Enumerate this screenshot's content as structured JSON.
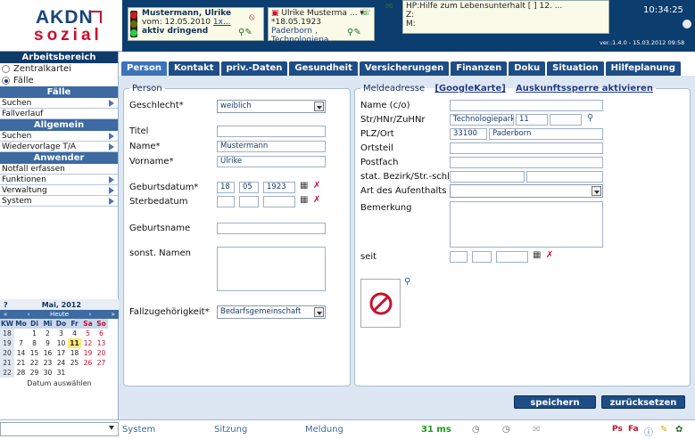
{
  "logo": {
    "line1": "AKDN",
    "line2": "sozial"
  },
  "header": {
    "case1": {
      "name": "Mustermann, Ulrike",
      "date_prefix": "vom: 12.05.2010",
      "link": "1x...",
      "status": "aktiv dringend"
    },
    "case2": {
      "name": "Ulrike Musterma ...",
      "date": "*18.05.1923",
      "addr": "Paderborn , Technologiepa ..."
    },
    "case3": {
      "line1": "HP:Hilfe zum Lebensunterhalt [ ] 12. ...",
      "line2": "Z:",
      "line3": "M:"
    },
    "time": "10:34:25",
    "version": "ver.:1.4.0 - 15.03.2012 09:58"
  },
  "sidebar": {
    "title": "Arbeitsbereich",
    "radios": [
      {
        "label": "Zentralkartei",
        "checked": false
      },
      {
        "label": "Fälle",
        "checked": true
      }
    ],
    "sections": [
      {
        "title": "Fälle",
        "items": [
          "Suchen",
          "Fallverlauf"
        ]
      },
      {
        "title": "Allgemein",
        "items": [
          "Suchen",
          "Wiedervorlage T/A"
        ]
      },
      {
        "title": "Anwender",
        "items": [
          "Notfall erfassen",
          "Funktionen",
          "Verwaltung",
          "System"
        ]
      }
    ]
  },
  "calendar": {
    "help": "?",
    "month": "Mai, 2012",
    "nav_prev2": "«",
    "nav_prev": "‹",
    "today": "Heute",
    "nav_next": "›",
    "nav_next2": "»",
    "days": [
      "KW",
      "Mo",
      "Di",
      "Mi",
      "Do",
      "Fr",
      "Sa",
      "So"
    ],
    "weeks": [
      [
        "18",
        "",
        "1",
        "2",
        "3",
        "4",
        "5",
        "6"
      ],
      [
        "19",
        "7",
        "8",
        "9",
        "10",
        "11",
        "12",
        "13"
      ],
      [
        "20",
        "14",
        "15",
        "16",
        "17",
        "18",
        "19",
        "20"
      ],
      [
        "21",
        "21",
        "22",
        "23",
        "24",
        "25",
        "26",
        "27"
      ],
      [
        "22",
        "28",
        "29",
        "30",
        "31",
        "",
        "",
        ""
      ]
    ],
    "footer": "Datum auswählen"
  },
  "tabs": [
    "Person",
    "Kontakt",
    "priv.-Daten",
    "Gesundheit",
    "Versicherungen",
    "Finanzen",
    "Doku",
    "Situation",
    "Hilfeplanung"
  ],
  "person": {
    "legend": "Person",
    "geschlecht_label": "Geschlecht*",
    "geschlecht": "weiblich",
    "titel_label": "Titel",
    "name_label": "Name*",
    "name": "Mustermann",
    "vorname_label": "Vorname*",
    "vorname": "Ulrike",
    "geb_label": "Geburtsdatum*",
    "geb_d": "18",
    "geb_m": "05",
    "geb_y": "1923",
    "sterbe_label": "Sterbedatum",
    "geburtsname_label": "Geburtsname",
    "sonst_label": "sonst. Namen",
    "fallzug_label": "Fallzugehörigkeit*",
    "fallzug": "Bedarfsgemeinschaft"
  },
  "address": {
    "legend": "Meldeadresse",
    "google": "[GoogleKarte]",
    "sperre": "Auskunftssperre aktivieren",
    "nameco_label": "Name (c/o)",
    "str_label": "Str/HNr/ZuHNr",
    "str": "Technologiepark",
    "hnr": "11",
    "plz_label": "PLZ/Ort",
    "plz": "33100",
    "ort": "Paderborn",
    "ortsteil_label": "Ortsteil",
    "postfach_label": "Postfach",
    "bezirk_label": "stat. Bezirk/Str.-schl.",
    "aufenthalt_label": "Art des Aufenthalts",
    "bemerkung_label": "Bemerkung",
    "seit_label": "seit"
  },
  "buttons": {
    "save": "speichern",
    "reset": "zurücksetzen"
  },
  "status": {
    "system": "System",
    "sitzung": "Sitzung",
    "meldung": "Meldung",
    "ms": "31 ms"
  },
  "colors": {
    "nav": "#0f3b69",
    "tab": "#1e4d86",
    "accent": "#c8102e",
    "ms": "#1a9a1a"
  }
}
